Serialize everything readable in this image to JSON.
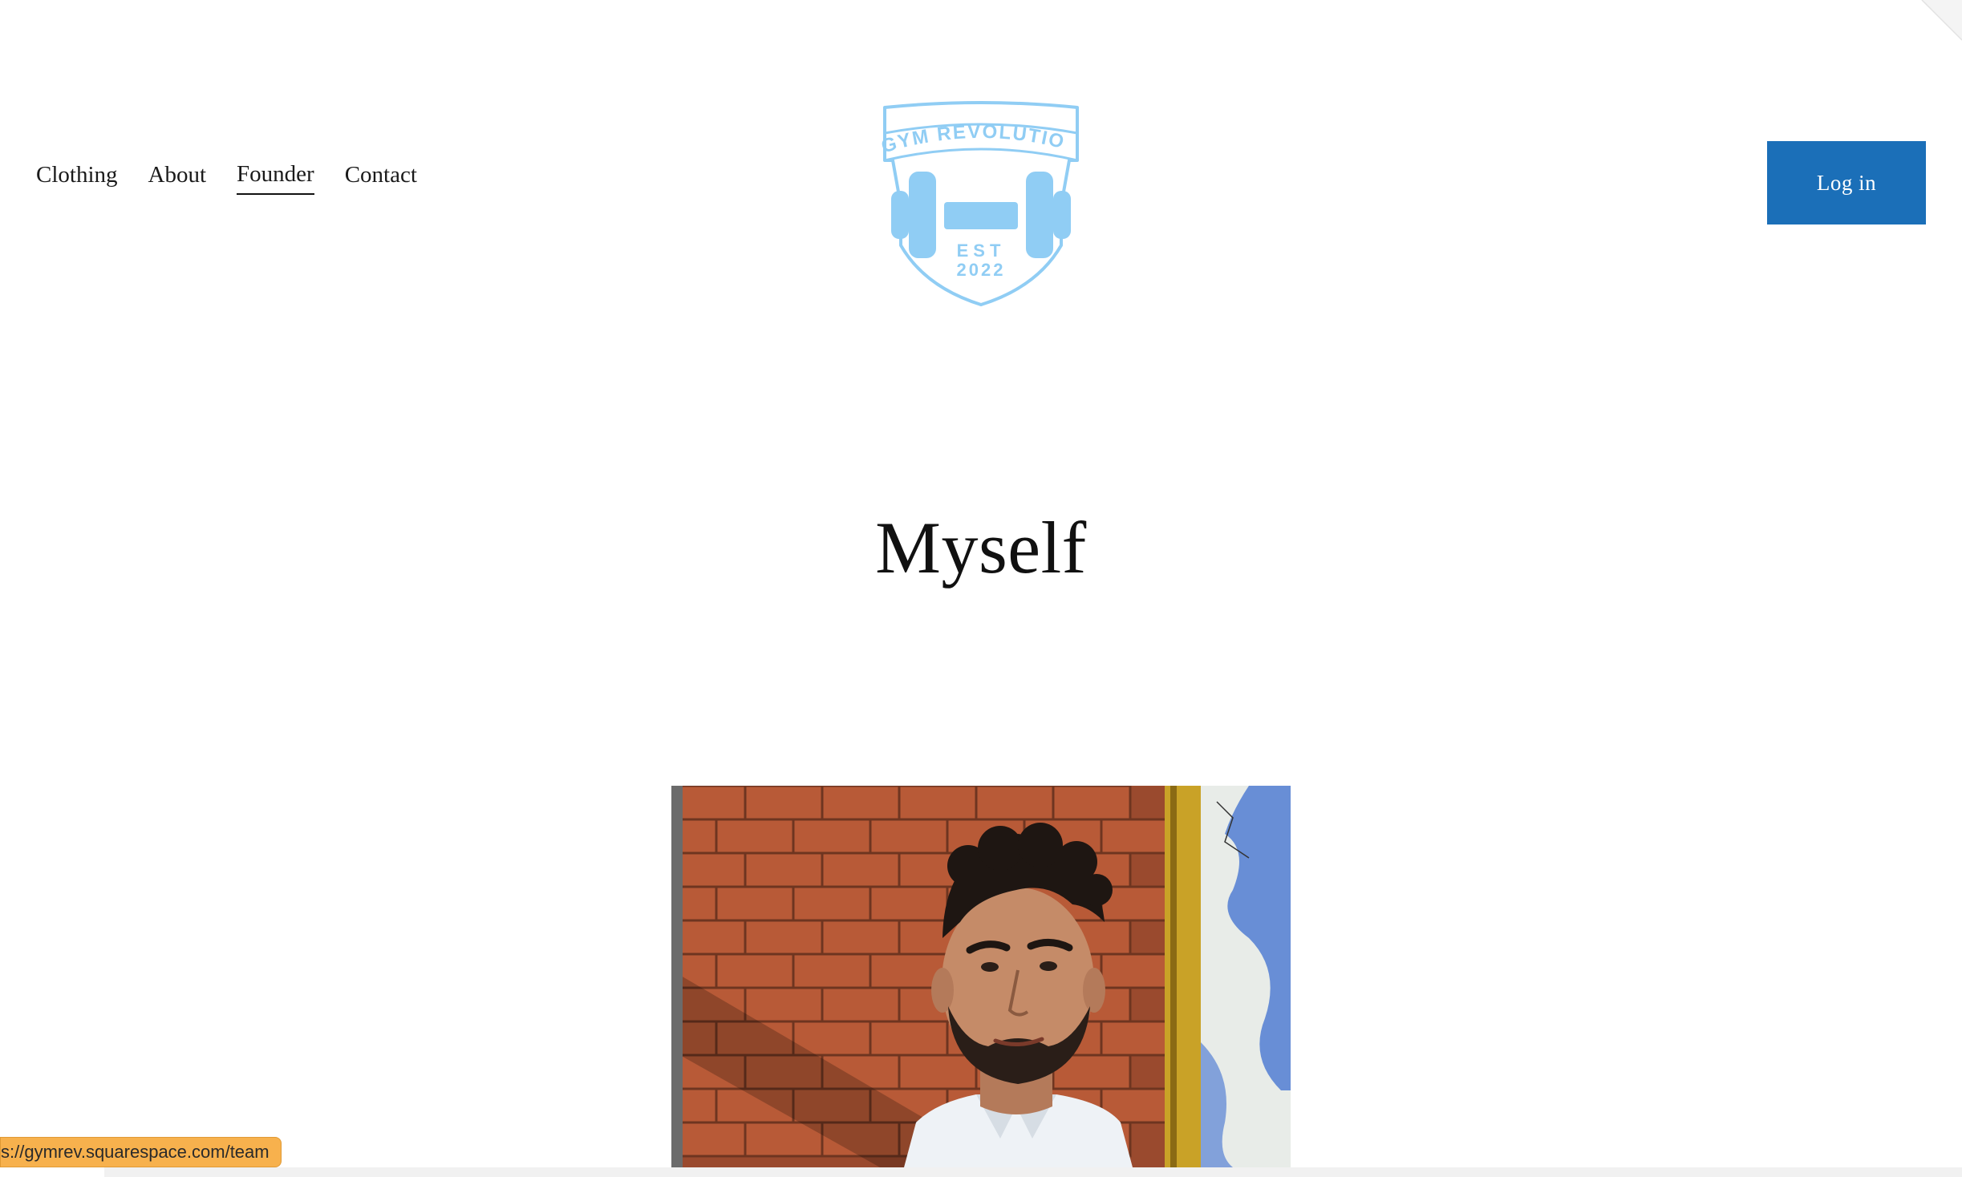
{
  "header": {
    "nav": [
      {
        "label": "Clothing",
        "active": false
      },
      {
        "label": "About",
        "active": false
      },
      {
        "label": "Founder",
        "active": true
      },
      {
        "label": "Contact",
        "active": false
      }
    ],
    "logo": {
      "top_text": "GYM REVOLUTION",
      "est_text": "EST",
      "year_text": "2022",
      "color": "#90cdf4",
      "icon": "dumbbell-crest-logo"
    },
    "login_label": "Log in",
    "login_color": "#1b6fb8"
  },
  "main": {
    "title": "Myself",
    "photo": {
      "icon": "founder-portrait-photo"
    }
  },
  "status_bar": {
    "url": "s://gymrev.squarespace.com/team"
  }
}
